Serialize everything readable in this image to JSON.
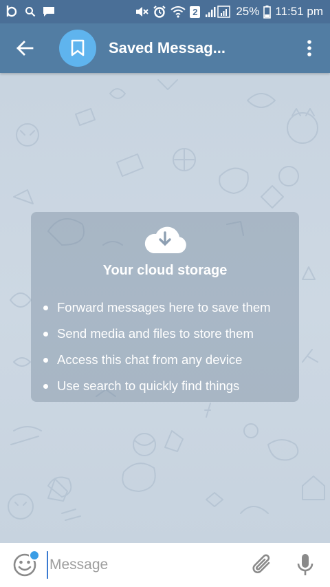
{
  "status_bar": {
    "sim_label": "2",
    "battery_percent": "25%",
    "time": "11:51 pm",
    "icons": [
      "b-app-icon",
      "search-icon",
      "message-icon",
      "mute-icon",
      "alarm-icon",
      "wifi-icon",
      "signal-icon",
      "battery-icon"
    ]
  },
  "app_bar": {
    "title": "Saved Messag...",
    "back_icon": "arrow-back-icon",
    "avatar_icon": "bookmark-icon",
    "menu_icon": "more-vert-icon",
    "bar_color": "#527da3",
    "avatar_color": "#5fb4ee"
  },
  "info_card": {
    "icon": "cloud-download-icon",
    "title": "Your cloud storage",
    "items": [
      "Forward messages here to save them",
      "Send media and files to store them",
      "Access this chat from any device",
      "Use search to quickly find things"
    ]
  },
  "input_bar": {
    "placeholder": "Message",
    "value": "",
    "icons": [
      "emoji-icon",
      "attach-icon",
      "mic-icon"
    ],
    "accent_color": "#3a9de5"
  }
}
